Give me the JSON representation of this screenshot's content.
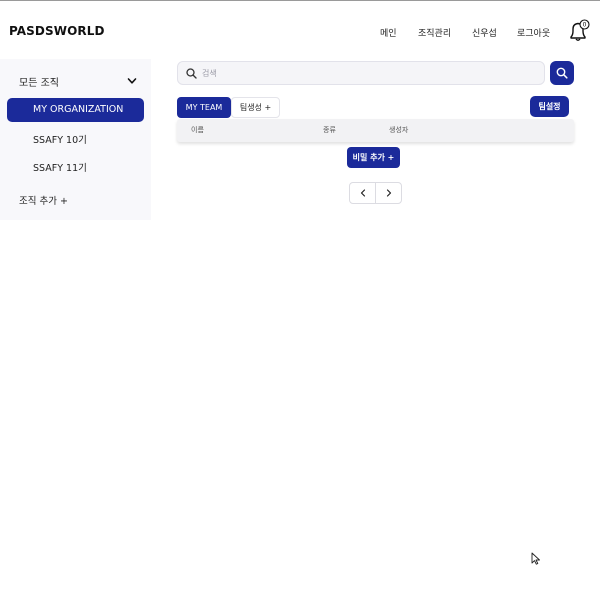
{
  "header": {
    "logo": "PASDSWORLD",
    "nav": [
      {
        "label": "메인"
      },
      {
        "label": "조직관리"
      },
      {
        "label": "신우섭"
      },
      {
        "label": "로그아웃"
      }
    ],
    "notification_count": "0",
    "bell_icon": "bell-icon"
  },
  "sidebar": {
    "header_label": "모든 조직",
    "chevron_icon": "chevron-down-icon",
    "items": [
      {
        "label": "MY ORGANIZATION",
        "active": true
      },
      {
        "label": "SSAFY 10기",
        "active": false
      },
      {
        "label": "SSAFY 11기",
        "active": false
      }
    ],
    "add_label": "조직 추가 +"
  },
  "search": {
    "placeholder": "검색",
    "value": "",
    "icon": "search-icon"
  },
  "tabs": [
    {
      "label": "MY TEAM",
      "active": true
    },
    {
      "label": "팀생성 +",
      "active": false
    }
  ],
  "team_setting_label": "팀설정",
  "table": {
    "columns": [
      "이름",
      "종류",
      "생성자"
    ],
    "rows": []
  },
  "add_secret_label": "비밀 추가 +",
  "pagination": {
    "prev_icon": "chevron-left-icon",
    "next_icon": "chevron-right-icon"
  },
  "colors": {
    "accent": "#1b2a9a",
    "sidebar_bg": "#f8f8fb",
    "table_header_bg": "#f2f2f4"
  }
}
